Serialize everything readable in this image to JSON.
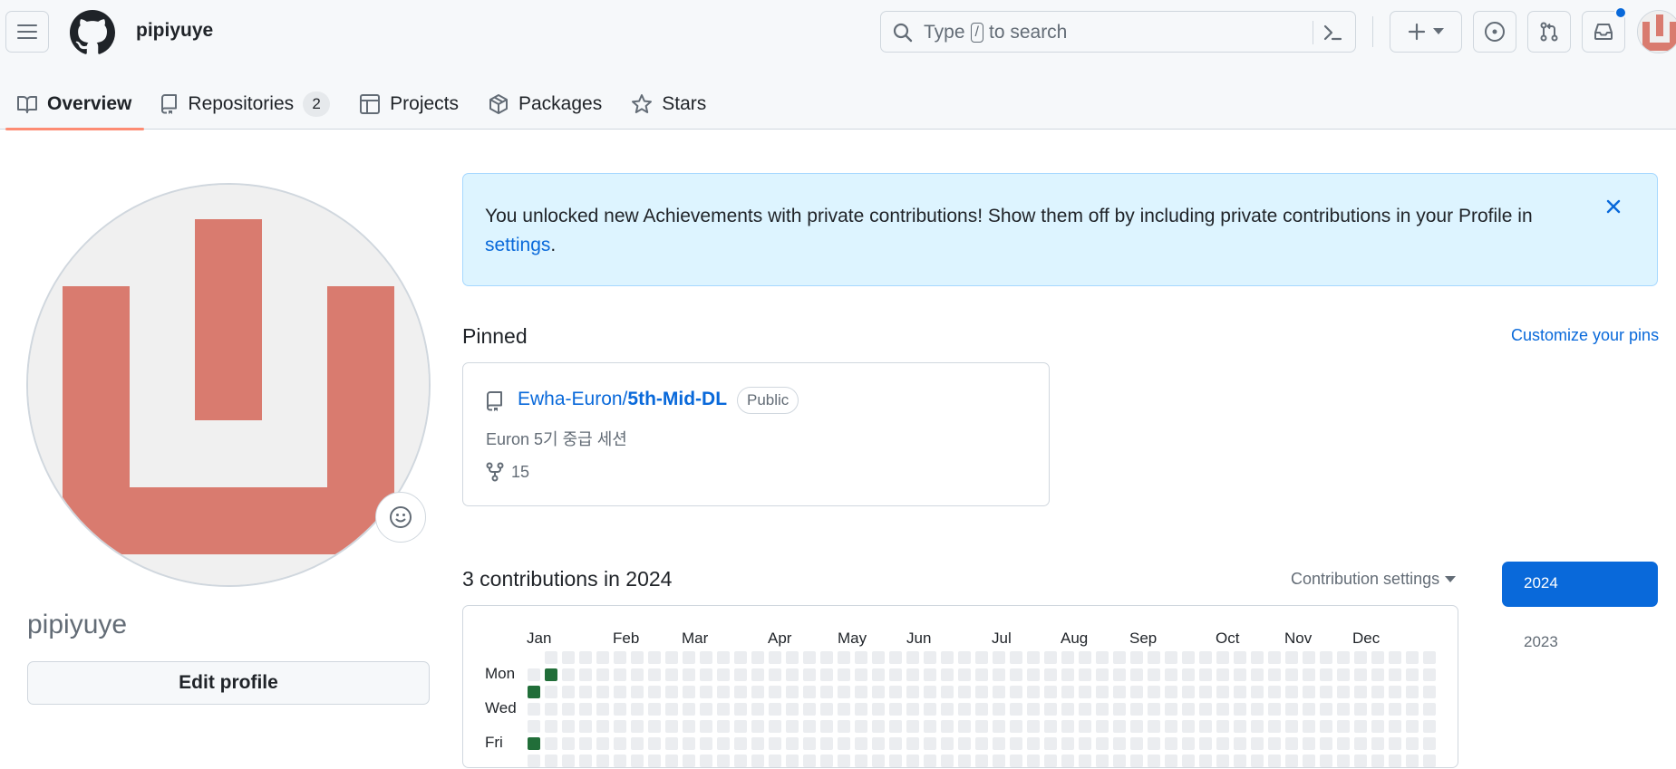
{
  "header": {
    "username": "pipiyuye",
    "search": {
      "before": "Type",
      "kbd": "/",
      "after": "to search"
    },
    "icons": [
      "hamburger-icon",
      "github-logo-icon",
      "search-icon",
      "command-palette-icon",
      "plus-icon",
      "triangle-down-icon",
      "issues-icon",
      "pull-requests-icon",
      "inbox-icon"
    ],
    "notification_dot_color": "#0969da"
  },
  "nav": {
    "tabs": [
      {
        "label": "Overview",
        "icon": "book-icon",
        "active": true
      },
      {
        "label": "Repositories",
        "icon": "repo-icon",
        "count": "2"
      },
      {
        "label": "Projects",
        "icon": "table-icon"
      },
      {
        "label": "Packages",
        "icon": "package-icon"
      },
      {
        "label": "Stars",
        "icon": "star-icon"
      }
    ]
  },
  "profile": {
    "name": "pipiyuye",
    "edit_label": "Edit profile",
    "avatar_color": "#d97b6f"
  },
  "flash": {
    "message": "You unlocked new Achievements with private contributions! Show them off by including private contributions in your Profile in ",
    "link": "settings",
    "end": "."
  },
  "pinned": {
    "title": "Pinned",
    "customize": "Customize your pins",
    "repo": {
      "owner": "Ewha-Euron/",
      "name": "5th-Mid-DL",
      "visibility": "Public",
      "description": "Euron 5기 중급 세션",
      "forks": "15"
    }
  },
  "contributions": {
    "title": "3 contributions in 2024",
    "settings_label": "Contribution settings",
    "months": [
      "Jan",
      "Feb",
      "Mar",
      "Apr",
      "May",
      "Jun",
      "Jul",
      "Aug",
      "Sep",
      "Oct",
      "Nov",
      "Dec"
    ],
    "day_labels": [
      "Mon",
      "Wed",
      "Fri"
    ],
    "active_cells": [
      {
        "week": 1,
        "day": "Mon"
      },
      {
        "week": 0,
        "day": "Tue"
      },
      {
        "week": 0,
        "day": "Fri"
      }
    ],
    "colors": {
      "empty": "#ebedf0",
      "level": "#216e39"
    }
  },
  "years": {
    "selected": "2024",
    "other": "2023"
  }
}
